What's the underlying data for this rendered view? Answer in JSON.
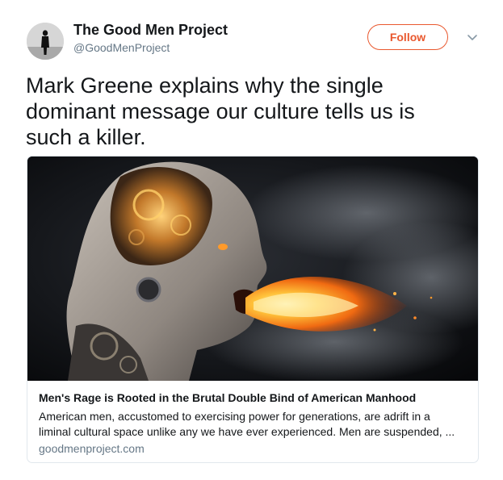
{
  "account": {
    "display_name": "The Good Men Project",
    "handle": "@GoodMenProject",
    "follow_label": "Follow",
    "accent_color": "#e9582e"
  },
  "tweet": {
    "text_lines": [
      "Mark Greene explains why the single",
      "dominant message our culture tells us is",
      "such a killer."
    ]
  },
  "card": {
    "title": "Men's Rage is Rooted in the Brutal Double Bind of American Manhood",
    "description_lines": [
      "American men, accustomed to exercising power for generations, are adrift in a",
      "liminal cultural space unlike any we have ever experienced. Men are suspended, ..."
    ],
    "domain": "goodmenproject.com",
    "image_icon": "robotic-head-breathing-fire-image"
  },
  "icons": {
    "avatar": "man-silhouette-avatar-icon",
    "menu": "chevron-down-icon"
  }
}
